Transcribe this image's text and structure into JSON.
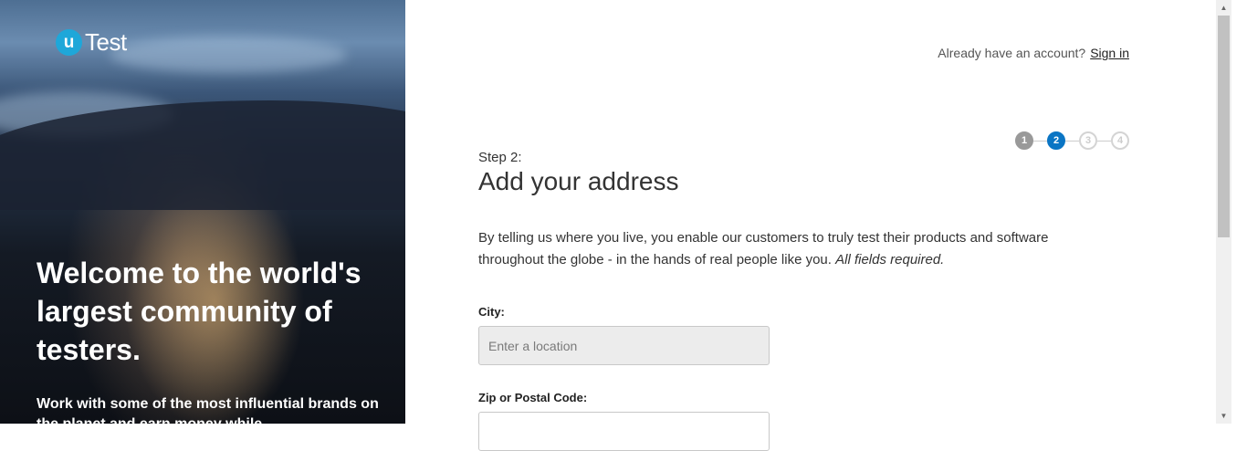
{
  "brand": {
    "logo_mark": "u",
    "logo_text": "Test"
  },
  "hero": {
    "headline": "Welcome to the world's largest community of testers.",
    "tagline": "Work with some of the most influential brands on the planet and earn money while"
  },
  "header": {
    "account_prompt": "Already have an account?",
    "sign_in_label": "Sign in"
  },
  "progress": {
    "current_step": 2,
    "total_steps": 4,
    "steps": [
      {
        "label": "1",
        "state": "done"
      },
      {
        "label": "2",
        "state": "active"
      },
      {
        "label": "3",
        "state": "todo"
      },
      {
        "label": "4",
        "state": "todo"
      }
    ]
  },
  "form": {
    "step_label": "Step 2:",
    "title": "Add your address",
    "intro": "By telling us where you live, you enable our customers to truly test their products and software throughout the globe - in the hands of real people like you.",
    "intro_emphasis": "All fields required.",
    "city": {
      "label": "City:",
      "placeholder": "Enter a location",
      "value": ""
    },
    "zip": {
      "label": "Zip or Postal Code:",
      "placeholder": "",
      "value": ""
    }
  },
  "colors": {
    "accent": "#0a75c4",
    "logo": "#1ea7d9",
    "step_done": "#999999",
    "step_todo": "#d4d4d4"
  },
  "icons": {
    "scroll_up": "scroll-up-arrow-icon",
    "scroll_down": "scroll-down-arrow-icon"
  }
}
